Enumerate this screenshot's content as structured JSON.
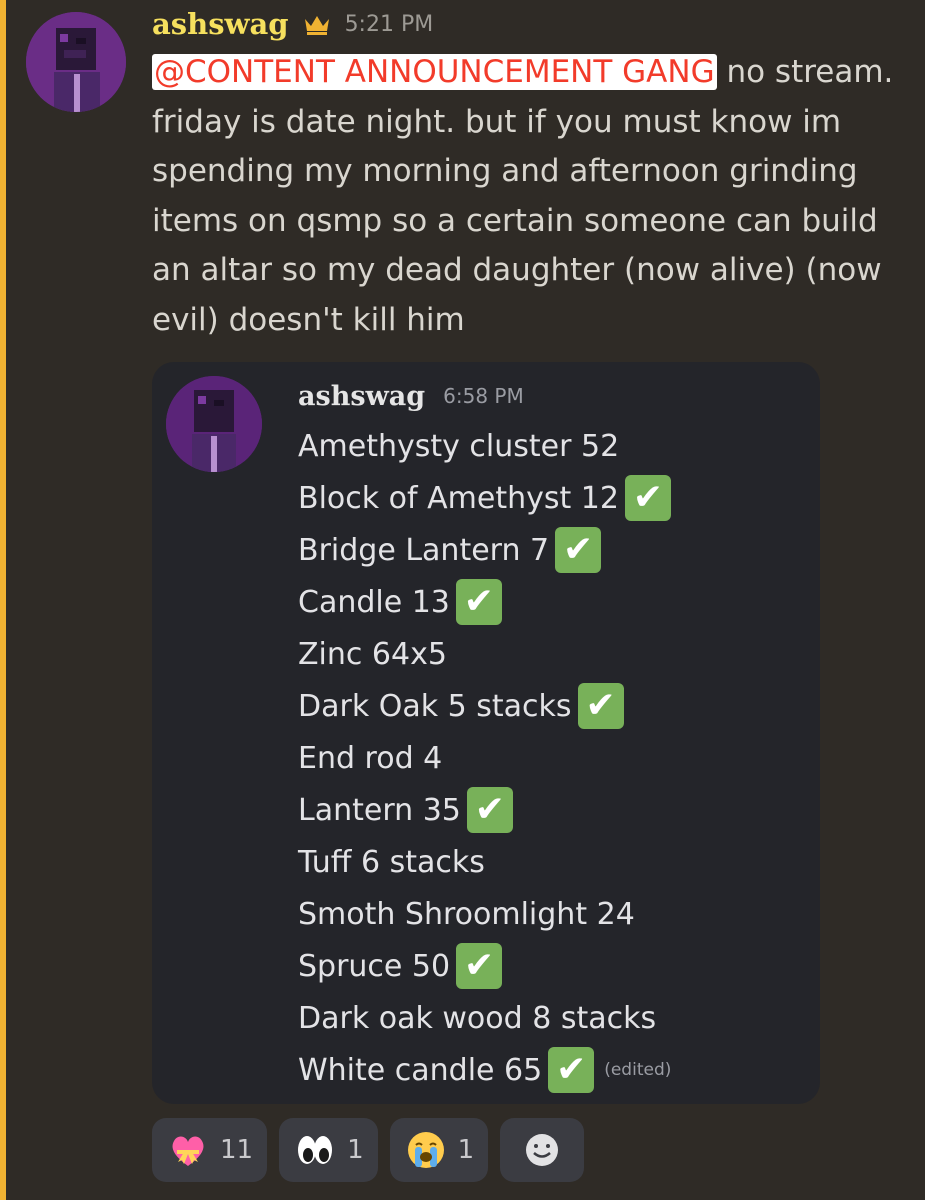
{
  "message": {
    "username": "ashswag",
    "crown_icon": "crown-icon",
    "timestamp": "5:21 PM",
    "mention": "@CONTENT ANNOUNCEMENT GANG",
    "text": " no stream. friday is date night. but if you must know im spending my morning and afternoon grinding items on qsmp so a certain someone can build an altar so my dead daughter (now alive) (now evil) doesn't kill him"
  },
  "embed": {
    "username": "ashswag",
    "timestamp": "6:58 PM",
    "edited_label": "(edited)",
    "items": [
      {
        "text": "Amethysty cluster 52",
        "checked": false
      },
      {
        "text": "Block of Amethyst 12",
        "checked": true
      },
      {
        "text": "Bridge Lantern 7",
        "checked": true
      },
      {
        "text": "Candle 13",
        "checked": true
      },
      {
        "text": "Zinc 64x5",
        "checked": false
      },
      {
        "text": "Dark Oak 5 stacks",
        "checked": true
      },
      {
        "text": "End rod 4",
        "checked": false
      },
      {
        "text": "Lantern 35",
        "checked": true
      },
      {
        "text": "Tuff 6 stacks",
        "checked": false
      },
      {
        "text": "Smoth Shroomlight 24",
        "checked": false
      },
      {
        "text": "Spruce 50",
        "checked": true
      },
      {
        "text": "Dark oak wood 8 stacks",
        "checked": false
      },
      {
        "text": "White candle 65",
        "checked": true
      }
    ]
  },
  "reactions": [
    {
      "emoji": "heart-with-ribbon-icon",
      "count": "11"
    },
    {
      "emoji": "eyes-icon",
      "count": "1"
    },
    {
      "emoji": "loudly-crying-face-icon",
      "count": "1"
    }
  ],
  "add_reaction_icon": "smiley-add-reaction-icon",
  "colors": {
    "accent_bar": "#f0b232",
    "username": "#f6e05e",
    "mention": "#f23b2a",
    "check": "#78b159"
  }
}
